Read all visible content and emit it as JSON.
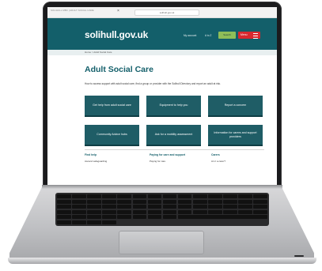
{
  "browser": {
    "tab_text": "SOLIHULL MBC | ADULT SOCIAL CARE",
    "address": "solihull.gov.uk"
  },
  "header": {
    "logo": "solihull.gov.uk",
    "nav": {
      "my_account": "My account",
      "a_to_z": "A to Z"
    },
    "search_label": "Search",
    "menu_label": "Menu"
  },
  "breadcrumb": "Home > Adult Social Care",
  "main": {
    "title": "Adult Social Care",
    "intro": "How to access support with adult social care, find a group or provider with the Solihull Directory and report an adult at risk.",
    "tiles": [
      {
        "label": "Get help from adult social care"
      },
      {
        "label": "Equipment to help you"
      },
      {
        "label": "Report a concern"
      },
      {
        "label": "Community Advice hubs"
      },
      {
        "label": "Ask for a mobility assessment"
      },
      {
        "label": "Information for carers and support providers"
      }
    ]
  },
  "footer_cols": [
    {
      "head": "Find help",
      "item": "Ascend safeguarding"
    },
    {
      "head": "Paying for care and support",
      "item": "Paying for care"
    },
    {
      "head": "Carers",
      "item": "Am I a carer?"
    }
  ],
  "colors": {
    "brand_teal": "#135f6a",
    "tile": "#1f5d66",
    "search_green": "#8fbe58",
    "menu_red": "#d9282f"
  }
}
